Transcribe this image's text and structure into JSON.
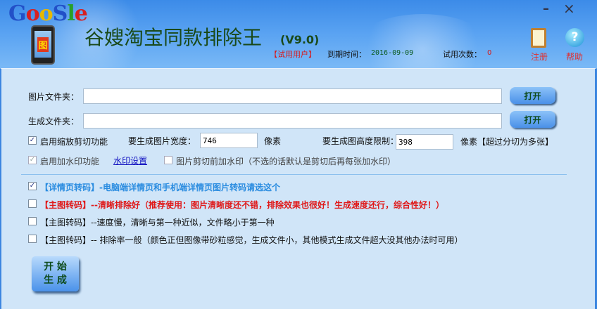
{
  "header": {
    "logo_text": "GooSle",
    "logo_icon_text": "图",
    "title": "谷嫂淘宝同款排除王",
    "version": "(V9.0)",
    "user_type": "【试用用户】",
    "expire_label": "到期时间：",
    "expire_value": "2016-09-09",
    "trial_label": "试用次数：",
    "trial_value": "0",
    "register_label": "注册",
    "help_label": "帮助"
  },
  "form": {
    "image_folder_label": "图片文件夹：",
    "image_folder_value": "",
    "output_folder_label": "生成文件夹：",
    "output_folder_value": "",
    "open_label": "打开",
    "enable_crop_label": "启用缩放剪切功能",
    "enable_crop_checked": true,
    "width_label": "要生成图片宽度：",
    "width_value": "746",
    "px_label": "像素",
    "height_label": "要生成图高度限制：",
    "height_value": "398",
    "height_unit": "像素【超过分切为多张】",
    "watermark_label": "启用加水印功能",
    "watermark_checked": true,
    "watermark_settings": "水印设置",
    "watermark_before_label": "图片剪切前加水印（不选的话默认是剪切后再每张加水印）",
    "watermark_before_checked": false
  },
  "options": [
    {
      "label": "【详情页转码】-电脑端详情页和手机端详情页图片转码请选这个",
      "checked": true
    },
    {
      "label": "【主图转码】--清晰排除好（推荐使用：图片清晰度还不错，排除效果也很好！生成速度还行，综合性好！）",
      "checked": false
    },
    {
      "label": "【主图转码】--速度慢，清晰与第一种近似，文件略小于第一种",
      "checked": false
    },
    {
      "label": "【主图转码】-- 排除率一般（颜色正但图像带砂粒感觉，生成文件小，其他模式生成文件超大没其他办法时可用）",
      "checked": false
    }
  ],
  "start_button": {
    "line1": "开 始",
    "line2": "生 成"
  },
  "colors": {
    "accent": "#3c86e0",
    "red": "#e01818",
    "link": "#1010c0",
    "blue_option": "#2a8ce0"
  }
}
